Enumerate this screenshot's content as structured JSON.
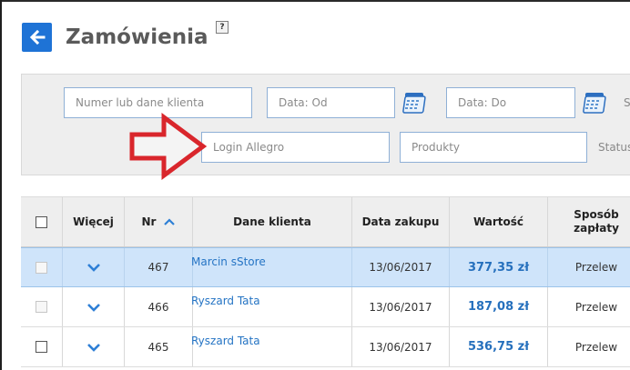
{
  "header": {
    "title": "Zamówienia",
    "help_label": "?"
  },
  "filters": {
    "customer_placeholder": "Numer lub dane klienta",
    "date_from_placeholder": "Data: Od",
    "date_to_placeholder": "Data: Do",
    "login_placeholder": "Login Allegro",
    "products_placeholder": "Produkty",
    "cut_label_top": "S",
    "status_label": "Status"
  },
  "annotation": {
    "arrow_color": "#d9262c"
  },
  "table": {
    "columns": {
      "more": "Więcej",
      "nr": "Nr",
      "client": "Dane klienta",
      "date": "Data zakupu",
      "value": "Wartość",
      "payment_line1": "Sposób",
      "payment_line2": "zapłaty"
    },
    "rows": [
      {
        "nr": "467",
        "client": "Marcin sStore",
        "date": "13/06/2017",
        "value": "377,35 zł",
        "payment": "Przelew",
        "selected": true
      },
      {
        "nr": "466",
        "client": "Ryszard Tata",
        "date": "13/06/2017",
        "value": "187,08 zł",
        "payment": "Przelew",
        "selected": false
      },
      {
        "nr": "465",
        "client": "Ryszard Tata",
        "date": "13/06/2017",
        "value": "536,75 zł",
        "payment": "Przelew",
        "selected": false
      }
    ]
  },
  "colors": {
    "accent": "#1e73d6",
    "link": "#2574c4",
    "selected_row": "#cfe4fa"
  },
  "icons": {
    "back": "arrow-left-icon",
    "calendar": "calendar-icon",
    "sort": "chevron-up-icon",
    "expand": "chevron-down-icon"
  }
}
